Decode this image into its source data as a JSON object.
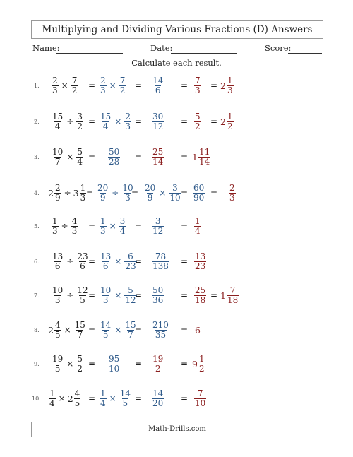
{
  "title": "Multiplying and Dividing Various Fractions (D) Answers",
  "header": {
    "name_label": "Name:",
    "date_label": "Date:",
    "score_label": "Score:"
  },
  "instructions": "Calculate each result.",
  "footer": "Math-Drills.com",
  "colors": {
    "step": "#2f5a8a",
    "answer": "#8b1f1f"
  },
  "problems": [
    {
      "number": "1.",
      "problem": [
        {
          "n": "2",
          "d": "3"
        },
        {
          "op": "×"
        },
        {
          "n": "7",
          "d": "2"
        }
      ],
      "step1": [
        {
          "n": "2",
          "d": "3"
        },
        {
          "op": "×"
        },
        {
          "n": "7",
          "d": "2"
        }
      ],
      "step2": null,
      "product": {
        "n": "14",
        "d": "6"
      },
      "simplified": {
        "n": "7",
        "d": "3"
      },
      "mixed": {
        "w": "2",
        "n": "1",
        "d": "3"
      }
    },
    {
      "number": "2.",
      "problem": [
        {
          "n": "15",
          "d": "4"
        },
        {
          "op": "÷"
        },
        {
          "n": "3",
          "d": "2"
        }
      ],
      "step1": [
        {
          "n": "15",
          "d": "4"
        },
        {
          "op": "×"
        },
        {
          "n": "2",
          "d": "3"
        }
      ],
      "step2": null,
      "product": {
        "n": "30",
        "d": "12"
      },
      "simplified": {
        "n": "5",
        "d": "2"
      },
      "mixed": {
        "w": "2",
        "n": "1",
        "d": "2"
      }
    },
    {
      "number": "3.",
      "problem": [
        {
          "n": "10",
          "d": "7"
        },
        {
          "op": "×"
        },
        {
          "n": "5",
          "d": "4"
        }
      ],
      "step1": null,
      "step2": null,
      "product": {
        "n": "50",
        "d": "28"
      },
      "simplified": {
        "n": "25",
        "d": "14"
      },
      "mixed": {
        "w": "1",
        "n": "11",
        "d": "14"
      }
    },
    {
      "number": "4.",
      "problem": [
        {
          "w": "2",
          "n": "2",
          "d": "9"
        },
        {
          "op": "÷"
        },
        {
          "w": "3",
          "n": "1",
          "d": "3"
        }
      ],
      "step1": [
        {
          "n": "20",
          "d": "9"
        },
        {
          "op": "÷"
        },
        {
          "n": "10",
          "d": "3"
        }
      ],
      "step2": [
        {
          "n": "20",
          "d": "9"
        },
        {
          "op": "×"
        },
        {
          "n": "3",
          "d": "10"
        }
      ],
      "product": {
        "n": "60",
        "d": "90"
      },
      "simplified": {
        "n": "2",
        "d": "3"
      },
      "mixed": null
    },
    {
      "number": "5.",
      "problem": [
        {
          "n": "1",
          "d": "3"
        },
        {
          "op": "÷"
        },
        {
          "n": "4",
          "d": "3"
        }
      ],
      "step1": [
        {
          "n": "1",
          "d": "3"
        },
        {
          "op": "×"
        },
        {
          "n": "3",
          "d": "4"
        }
      ],
      "step2": null,
      "product": {
        "n": "3",
        "d": "12"
      },
      "simplified": {
        "n": "1",
        "d": "4"
      },
      "mixed": null
    },
    {
      "number": "6.",
      "problem": [
        {
          "n": "13",
          "d": "6"
        },
        {
          "op": "÷"
        },
        {
          "n": "23",
          "d": "6"
        }
      ],
      "step1": [
        {
          "n": "13",
          "d": "6"
        },
        {
          "op": "×"
        },
        {
          "n": "6",
          "d": "23"
        }
      ],
      "step2": null,
      "product": {
        "n": "78",
        "d": "138"
      },
      "simplified": {
        "n": "13",
        "d": "23"
      },
      "mixed": null
    },
    {
      "number": "7.",
      "problem": [
        {
          "n": "10",
          "d": "3"
        },
        {
          "op": "÷"
        },
        {
          "n": "12",
          "d": "5"
        }
      ],
      "step1": [
        {
          "n": "10",
          "d": "3"
        },
        {
          "op": "×"
        },
        {
          "n": "5",
          "d": "12"
        }
      ],
      "step2": null,
      "product": {
        "n": "50",
        "d": "36"
      },
      "simplified": {
        "n": "25",
        "d": "18"
      },
      "mixed": {
        "w": "1",
        "n": "7",
        "d": "18"
      }
    },
    {
      "number": "8.",
      "problem": [
        {
          "w": "2",
          "n": "4",
          "d": "5"
        },
        {
          "op": "×"
        },
        {
          "n": "15",
          "d": "7"
        }
      ],
      "step1": [
        {
          "n": "14",
          "d": "5"
        },
        {
          "op": "×"
        },
        {
          "n": "15",
          "d": "7"
        }
      ],
      "step2": null,
      "product": {
        "n": "210",
        "d": "35"
      },
      "simplified": {
        "w": "6"
      },
      "mixed": null
    },
    {
      "number": "9.",
      "problem": [
        {
          "n": "19",
          "d": "5"
        },
        {
          "op": "×"
        },
        {
          "n": "5",
          "d": "2"
        }
      ],
      "step1": null,
      "step2": null,
      "product": {
        "n": "95",
        "d": "10"
      },
      "simplified": {
        "n": "19",
        "d": "2"
      },
      "mixed": {
        "w": "9",
        "n": "1",
        "d": "2"
      }
    },
    {
      "number": "10.",
      "problem": [
        {
          "n": "1",
          "d": "4"
        },
        {
          "op": "×"
        },
        {
          "w": "2",
          "n": "4",
          "d": "5"
        }
      ],
      "step1": [
        {
          "n": "1",
          "d": "4"
        },
        {
          "op": "×"
        },
        {
          "n": "14",
          "d": "5"
        }
      ],
      "step2": null,
      "product": {
        "n": "14",
        "d": "20"
      },
      "simplified": {
        "n": "7",
        "d": "10"
      },
      "mixed": null
    }
  ]
}
